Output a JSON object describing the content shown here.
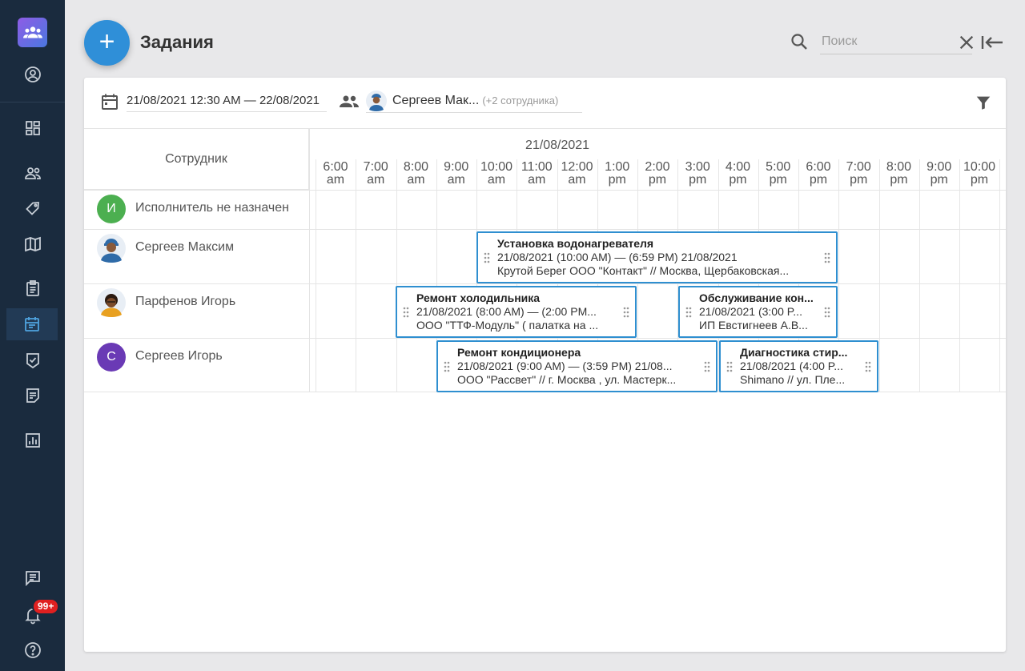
{
  "sidebar": {
    "icons": [
      "team-logo-icon",
      "account-icon",
      "dashboard-icon",
      "people-icon",
      "tag-icon",
      "map-icon",
      "clipboard-icon",
      "calendar-icon",
      "check-shield-icon",
      "notes-icon",
      "report-icon",
      "chat-icon",
      "bell-icon",
      "help-icon"
    ],
    "notification_badge": "99+"
  },
  "header": {
    "add_label": "+",
    "title": "Задания",
    "search_placeholder": "Поиск"
  },
  "filters": {
    "date_range": "21/08/2021 12:30 AM — 22/08/2021",
    "employee": "Сергеев Мак...",
    "employee_more": "(+2 сотрудника)"
  },
  "grid": {
    "employee_column": "Сотрудник",
    "date": "21/08/2021",
    "hours": [
      {
        "h": "6:00",
        "p": "am"
      },
      {
        "h": "7:00",
        "p": "am"
      },
      {
        "h": "8:00",
        "p": "am"
      },
      {
        "h": "9:00",
        "p": "am"
      },
      {
        "h": "10:00",
        "p": "am"
      },
      {
        "h": "11:00",
        "p": "am"
      },
      {
        "h": "12:00",
        "p": "am"
      },
      {
        "h": "1:00",
        "p": "pm"
      },
      {
        "h": "2:00",
        "p": "pm"
      },
      {
        "h": "3:00",
        "p": "pm"
      },
      {
        "h": "4:00",
        "p": "pm"
      },
      {
        "h": "5:00",
        "p": "pm"
      },
      {
        "h": "6:00",
        "p": "pm"
      },
      {
        "h": "7:00",
        "p": "pm"
      },
      {
        "h": "8:00",
        "p": "pm"
      },
      {
        "h": "9:00",
        "p": "pm"
      },
      {
        "h": "10:00",
        "p": "pm"
      }
    ]
  },
  "employees": [
    {
      "name": "Исполнитель не назначен",
      "initial": "И",
      "color": "#4caf50"
    },
    {
      "name": "Сергеев Максим"
    },
    {
      "name": "Парфенов Игорь"
    },
    {
      "name": "Сергеев Игорь",
      "initial": "С",
      "color": "#6a3ab5"
    }
  ],
  "tasks": [
    {
      "title": "Установка водонагревателя",
      "time": "21/08/2021 (10:00 AM) — (6:59 PM) 21/08/2021",
      "client": "Крутой Берег ООО \"Контакт\" // Москва, Щербаковская..."
    },
    {
      "title": "Ремонт холодильника",
      "time": "21/08/2021 (8:00 AM) — (2:00 PM...",
      "client": "ООО \"ТТФ-Модуль\" ( палатка на ..."
    },
    {
      "title": "Обслуживание кон...",
      "time": "21/08/2021 (3:00 P...",
      "client": "ИП Евстигнеев А.В..."
    },
    {
      "title": "Ремонт кондиционера",
      "time": "21/08/2021 (9:00 AM) — (3:59 PM) 21/08...",
      "client": "ООО \"Рассвет\" // г. Москва , ул. Мастерк..."
    },
    {
      "title": "Диагностика стир...",
      "time": "21/08/2021 (4:00 P...",
      "client": "Shimano // ул. Пле..."
    }
  ],
  "colors": {
    "sidebar": "#1a2b3e",
    "accent": "#2f8fd8",
    "task_border": "#2f8fd0"
  }
}
